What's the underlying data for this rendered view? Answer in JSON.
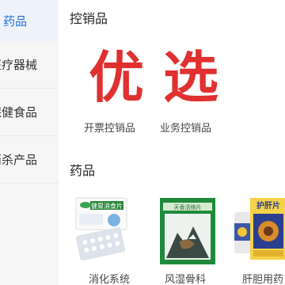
{
  "sidebar": {
    "items": [
      {
        "label": "药品"
      },
      {
        "label": "医疗器械"
      },
      {
        "label": "保健食品"
      },
      {
        "label": "消杀产品"
      }
    ]
  },
  "section_controlled": {
    "title": "控销品",
    "promo": {
      "char1": "优",
      "char2": "选"
    },
    "items": [
      {
        "label": "开票控销品"
      },
      {
        "label": "业务控销品"
      }
    ]
  },
  "section_drugs": {
    "title": "药品",
    "items": [
      {
        "label": "消化系统",
        "pack_text": "健胃消食片"
      },
      {
        "label": "风湿骨科",
        "pack_text": "天香活络片"
      },
      {
        "label": "肝胆用药",
        "pack_text": "护肝片"
      }
    ]
  },
  "colors": {
    "accent_blue": "#1e6fd9",
    "promo_red": "#e03030",
    "sidebar_bg": "#f6f6f6"
  }
}
